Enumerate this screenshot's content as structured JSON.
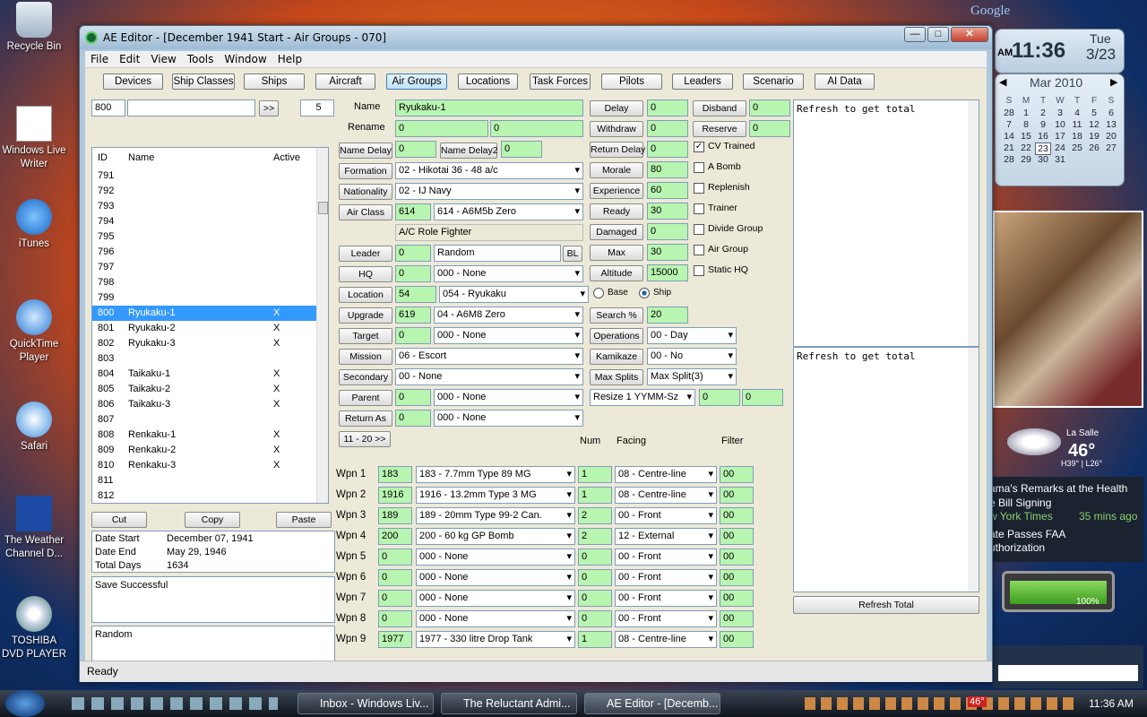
{
  "google_label": "Google",
  "desktop_icons": [
    "Recycle Bin",
    "Windows Live Writer",
    "iTunes",
    "QuickTime Player",
    "Safari",
    "The Weather Channel D...",
    "TOSHIBA DVD PLAYER"
  ],
  "clock": {
    "time": "11:36",
    "ampm": "AM",
    "day": "Tue",
    "date": "3/23"
  },
  "calendar": {
    "month": "Mar 2010",
    "headers": [
      "S",
      "M",
      "T",
      "W",
      "T",
      "F",
      "S"
    ],
    "weeks": [
      [
        "28",
        "1",
        "2",
        "3",
        "4",
        "5",
        "6"
      ],
      [
        "7",
        "8",
        "9",
        "10",
        "11",
        "12",
        "13"
      ],
      [
        "14",
        "15",
        "16",
        "17",
        "18",
        "19",
        "20"
      ],
      [
        "21",
        "22",
        "23",
        "24",
        "25",
        "26",
        "27"
      ],
      [
        "28",
        "29",
        "30",
        "31",
        "",
        "",
        ""
      ]
    ]
  },
  "weather": {
    "city": "La Salle",
    "temp": "46°",
    "hilo": "H39° | L26°"
  },
  "news": {
    "h1": "ama's Remarks at the Health",
    "h1b": "e Bill Signing",
    "src": "w York Times",
    "age": "35 mins ago",
    "h2": "ate Passes FAA",
    "h2b": "uthorization"
  },
  "meter": {
    "pct": "100%"
  },
  "window": {
    "title": "AE Editor - [December 1941 Start - Air Groups - 070]",
    "status": "Ready"
  },
  "menu": [
    "File",
    "Edit",
    "View",
    "Tools",
    "Window",
    "Help"
  ],
  "toolbar": [
    "Devices",
    "Ship Classes",
    "Ships",
    "Aircraft",
    "Air Groups",
    "Locations",
    "Task Forces",
    "Pilots",
    "Leaders",
    "Scenario",
    "AI Data"
  ],
  "search": {
    "id": "800",
    "text": "",
    "go": ">>",
    "count": "5"
  },
  "list": {
    "headers": [
      "ID",
      "Name",
      "Active"
    ],
    "rows": [
      [
        "791",
        "",
        ""
      ],
      [
        "792",
        "",
        ""
      ],
      [
        "793",
        "",
        ""
      ],
      [
        "794",
        "",
        ""
      ],
      [
        "795",
        "",
        ""
      ],
      [
        "796",
        "",
        ""
      ],
      [
        "797",
        "",
        ""
      ],
      [
        "798",
        "",
        ""
      ],
      [
        "799",
        "",
        ""
      ],
      [
        "800",
        "Ryukaku-1",
        "X"
      ],
      [
        "801",
        "Ryukaku-2",
        "X"
      ],
      [
        "802",
        "Ryukaku-3",
        "X"
      ],
      [
        "803",
        "",
        ""
      ],
      [
        "804",
        "Taikaku-1",
        "X"
      ],
      [
        "805",
        "Taikaku-2",
        "X"
      ],
      [
        "806",
        "Taikaku-3",
        "X"
      ],
      [
        "807",
        "",
        ""
      ],
      [
        "808",
        "Renkaku-1",
        "X"
      ],
      [
        "809",
        "Renkaku-2",
        "X"
      ],
      [
        "810",
        "Renkaku-3",
        "X"
      ],
      [
        "811",
        "",
        ""
      ],
      [
        "812",
        "",
        ""
      ]
    ]
  },
  "list_buttons": [
    "Cut",
    "Copy",
    "Paste"
  ],
  "dates": {
    "start_label": "Date Start",
    "start": "December 07, 1941",
    "end_label": "Date End",
    "end": "May 29, 1946",
    "total_label": "Total Days",
    "total": "1634"
  },
  "save_msg": "Save Successful",
  "random_msg": "Random",
  "form": {
    "name_label": "Name",
    "name": "Ryukaku-1",
    "rename_label": "Rename",
    "rename1": "0",
    "rename2": "0",
    "name_delay_btn": "Name Delay",
    "name_delay": "0",
    "name_delay2_btn": "Name Delay2",
    "name_delay2": "0",
    "formation_btn": "Formation",
    "formation": "02 - Hikotai 36 - 48 a/c",
    "nationality_btn": "Nationality",
    "nationality": "02 - IJ Navy",
    "airclass_btn": "Air Class",
    "airclass_id": "614",
    "airclass": "614 - A6M5b Zero",
    "ac_role": "A/C Role  Fighter",
    "leader_btn": "Leader",
    "leader_id": "0",
    "leader": "Random",
    "bl": "BL",
    "hq_btn": "HQ",
    "hq_id": "0",
    "hq": "000 - None",
    "location_btn": "Location",
    "location_id": "54",
    "location": "054 - Ryukaku",
    "upgrade_btn": "Upgrade",
    "upgrade_id": "619",
    "upgrade": "04 - A6M8 Zero",
    "target_btn": "Target",
    "target_id": "0",
    "target": "000 - None",
    "mission_btn": "Mission",
    "mission": "06 - Escort",
    "secondary_btn": "Secondary",
    "secondary": "00 - None",
    "parent_btn": "Parent",
    "parent_id": "0",
    "parent": "000 - None",
    "returnas_btn": "Return As",
    "returnas_id": "0",
    "returnas": "000 - None",
    "range_btn": "11 - 20 >>",
    "delay_btn": "Delay",
    "delay": "0",
    "disband_btn": "Disband",
    "disband": "0",
    "withdraw_btn": "Withdraw",
    "withdraw": "0",
    "reserve_btn": "Reserve",
    "reserve": "0",
    "return_delay_btn": "Return Delay",
    "return_delay": "0",
    "morale_btn": "Morale",
    "morale": "80",
    "experience_btn": "Experience",
    "experience": "60",
    "ready_btn": "Ready",
    "ready": "30",
    "damaged_btn": "Damaged",
    "damaged": "0",
    "max_btn": "Max",
    "max": "30",
    "altitude_btn": "Altitude",
    "altitude": "15000",
    "base_label": "Base",
    "ship_label": "Ship",
    "search_btn": "Search %",
    "search": "20",
    "operations_btn": "Operations",
    "operations": "00 - Day",
    "kamikaze_btn": "Kamikaze",
    "kamikaze": "00 - No",
    "maxsplits_btn": "Max Splits",
    "maxsplits": "Max Split(3)",
    "resize": "Resize 1 YYMM-Sz",
    "resize1": "0",
    "resize2": "0",
    "checks": [
      {
        "label": "CV Trained",
        "on": true
      },
      {
        "label": "A Bomb",
        "on": false
      },
      {
        "label": "Replenish",
        "on": false
      },
      {
        "label": "Trainer",
        "on": false
      },
      {
        "label": "Divide Group",
        "on": false
      },
      {
        "label": "Air Group",
        "on": false
      },
      {
        "label": "Static HQ",
        "on": false
      }
    ]
  },
  "weapons": {
    "col_num": "Num",
    "col_facing": "Facing",
    "col_filter": "Filter",
    "rows": [
      {
        "label": "Wpn 1",
        "id": "183",
        "dev": "183 - 7.7mm Type 89 MG",
        "num": "1",
        "facing": "08 - Centre-line",
        "filter": "00"
      },
      {
        "label": "Wpn 2",
        "id": "1916",
        "dev": "1916 - 13.2mm Type 3 MG",
        "num": "1",
        "facing": "08 - Centre-line",
        "filter": "00"
      },
      {
        "label": "Wpn 3",
        "id": "189",
        "dev": "189 - 20mm Type 99-2 Can.",
        "num": "2",
        "facing": "00 - Front",
        "filter": "00"
      },
      {
        "label": "Wpn 4",
        "id": "200",
        "dev": "200 - 60 kg GP Bomb",
        "num": "2",
        "facing": "12 - External",
        "filter": "00"
      },
      {
        "label": "Wpn 5",
        "id": "0",
        "dev": "000 - None",
        "num": "0",
        "facing": "00 - Front",
        "filter": "00"
      },
      {
        "label": "Wpn 6",
        "id": "0",
        "dev": "000 - None",
        "num": "0",
        "facing": "00 - Front",
        "filter": "00"
      },
      {
        "label": "Wpn 7",
        "id": "0",
        "dev": "000 - None",
        "num": "0",
        "facing": "00 - Front",
        "filter": "00"
      },
      {
        "label": "Wpn 8",
        "id": "0",
        "dev": "000 - None",
        "num": "0",
        "facing": "00 - Front",
        "filter": "00"
      },
      {
        "label": "Wpn 9",
        "id": "1977",
        "dev": "1977 - 330 litre Drop Tank",
        "num": "1",
        "facing": "08 - Centre-line",
        "filter": "00"
      }
    ]
  },
  "right_panels": {
    "text1": "Refresh to get total",
    "text2": "Refresh to get total",
    "refresh_btn": "Refresh Total"
  },
  "taskbar": {
    "tasks": [
      "Inbox - Windows Liv...",
      "The Reluctant Admi...",
      "AE Editor - [Decemb..."
    ],
    "time": "11:36 AM",
    "temp": "46°"
  }
}
